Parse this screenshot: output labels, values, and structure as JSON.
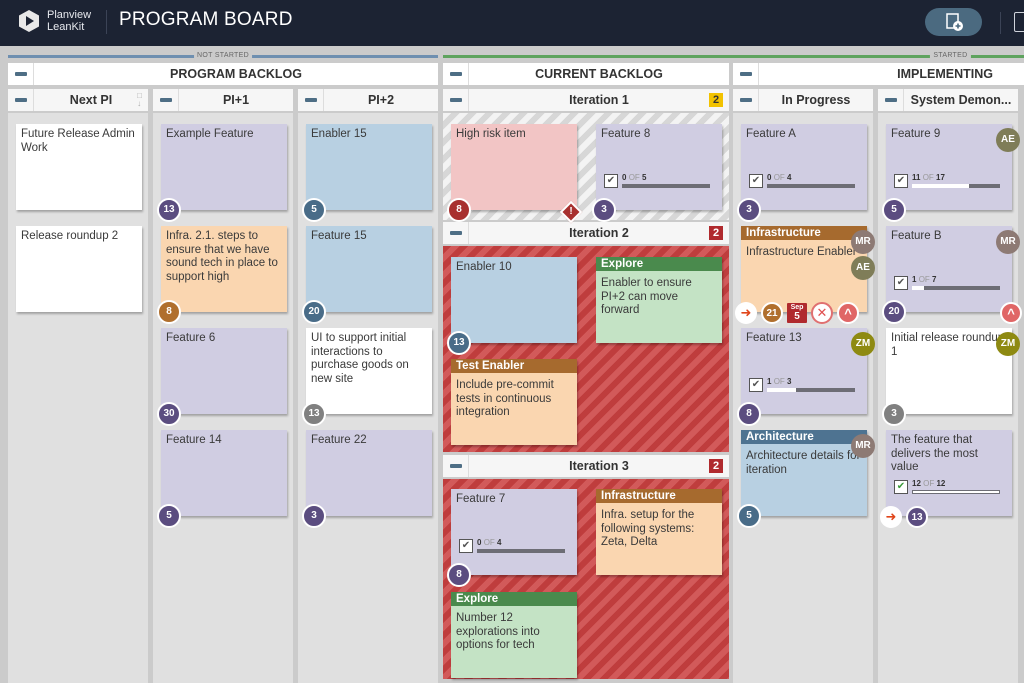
{
  "app": {
    "brand_line1": "Planview",
    "brand_line2": "LeanKit",
    "board_title": "PROGRAM BOARD",
    "add_card_icon": "add-card-icon"
  },
  "phases": {
    "not_started": "NOT STARTED",
    "started": "STARTED"
  },
  "lanes": {
    "program_backlog": "PROGRAM BACKLOG",
    "current_backlog": "CURRENT BACKLOG",
    "implementing": "IMPLEMENTING",
    "next_pi": "Next PI",
    "pi1": "PI+1",
    "pi2": "PI+2",
    "iteration1": {
      "title": "Iteration 1",
      "count": "2"
    },
    "iteration2": {
      "title": "Iteration 2",
      "count": "2"
    },
    "iteration3": {
      "title": "Iteration 3",
      "count": "2"
    },
    "in_progress": "In Progress",
    "system_demo": "System Demon..."
  },
  "cards": {
    "next_pi": [
      {
        "title": "Future Release Admin Work"
      },
      {
        "title": "Release roundup 2"
      }
    ],
    "pi1": [
      {
        "title": "Example Feature",
        "size": "13"
      },
      {
        "title": "Infra. 2.1. steps to ensure that we have sound tech in place to support high",
        "size": "8"
      },
      {
        "title": "Feature 6",
        "size": "30"
      },
      {
        "title": "Feature 14",
        "size": "5"
      }
    ],
    "pi2": [
      {
        "title": "Enabler 15",
        "size": "5"
      },
      {
        "title": "Feature 15",
        "size": "20"
      },
      {
        "title": "UI to support initial interactions to purchase goods on new site",
        "size": "13"
      },
      {
        "title": "Feature 22",
        "size": "3"
      }
    ],
    "iteration1": [
      {
        "title": "High risk item",
        "size": "8"
      },
      {
        "title": "Feature 8",
        "size": "3",
        "tasks_done": "0",
        "tasks_of": "OF",
        "tasks_total": "5",
        "progress": 0
      }
    ],
    "iteration2": [
      {
        "title": "Enabler 10",
        "size": "13"
      },
      {
        "type": "Explore",
        "title": "Enabler to ensure PI+2 can move forward"
      },
      {
        "type": "Test Enabler",
        "title": "Include pre-commit tests in continuous integration"
      }
    ],
    "iteration3": [
      {
        "title": "Feature 7",
        "size": "8",
        "tasks_done": "0",
        "tasks_of": "OF",
        "tasks_total": "4",
        "progress": 0
      },
      {
        "type": "Infrastructure",
        "title": "Infra. setup for the following systems: Zeta, Delta"
      },
      {
        "type": "Explore",
        "title": "Number 12 explorations into options for tech"
      }
    ],
    "in_progress": [
      {
        "title": "Feature A",
        "size": "3",
        "tasks_done": "0",
        "tasks_of": "OF",
        "tasks_total": "4",
        "progress": 0
      },
      {
        "type": "Infrastructure",
        "title": "Infrastructure Enabler",
        "avatars": [
          "MR",
          "AE"
        ],
        "size": "21",
        "due_month": "Sep",
        "due_day": "5"
      },
      {
        "title": "Feature 13",
        "size": "8",
        "avatars": [
          "ZM"
        ],
        "tasks_done": "1",
        "tasks_of": "OF",
        "tasks_total": "3",
        "progress": 0.33
      },
      {
        "type": "Architecture",
        "title": "Architecture details for iteration",
        "size": "5",
        "avatars": [
          "MR"
        ]
      }
    ],
    "system_demo": [
      {
        "title": "Feature 9",
        "size": "5",
        "avatars": [
          "AE"
        ],
        "tasks_done": "11",
        "tasks_of": "OF",
        "tasks_total": "17",
        "progress": 0.65
      },
      {
        "title": "Feature B",
        "size": "20",
        "avatars": [
          "MR"
        ],
        "tasks_done": "1",
        "tasks_of": "OF",
        "tasks_total": "7",
        "progress": 0.14
      },
      {
        "title": "Initial release roundup 1",
        "size": "3",
        "avatars": [
          "ZM"
        ]
      },
      {
        "title": "The feature that delivers the most value",
        "size": "13",
        "tasks_done": "12",
        "tasks_of": "OF",
        "tasks_total": "12",
        "progress": 1
      }
    ]
  },
  "colors": {
    "topbar": "#1c2333",
    "not_started": "#6e8fb0",
    "started": "#5ea35e",
    "badge_yellow": "#f2c200",
    "badge_red": "#b02a2e"
  }
}
